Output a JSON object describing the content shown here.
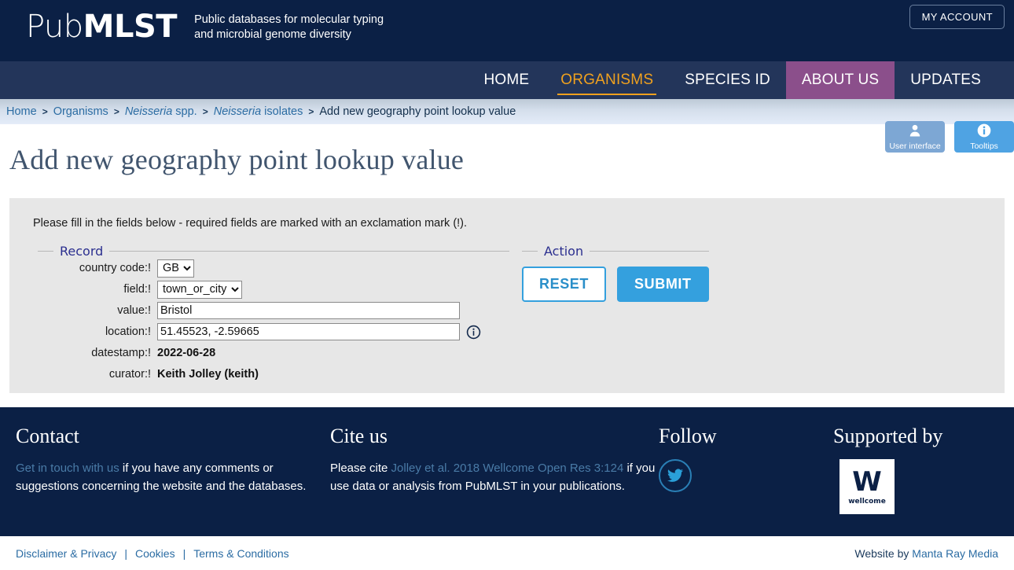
{
  "header": {
    "logo_light": "Pub",
    "logo_bold": "MLST",
    "tagline_line1": "Public databases for molecular typing",
    "tagline_line2": "and microbial genome diversity",
    "my_account_label": "MY ACCOUNT"
  },
  "nav": {
    "items": [
      {
        "label": "HOME",
        "state": "normal"
      },
      {
        "label": "ORGANISMS",
        "state": "active"
      },
      {
        "label": "SPECIES ID",
        "state": "normal"
      },
      {
        "label": "ABOUT US",
        "state": "hovered"
      },
      {
        "label": "UPDATES",
        "state": "normal"
      }
    ],
    "active_color": "#f0a11e",
    "hover_color": "#8b4f8b"
  },
  "breadcrumb": {
    "home": "Home",
    "organisms": "Organisms",
    "genus": "Neisseria",
    "genus_suffix": " spp.",
    "isolates_genus": "Neisseria",
    "isolates_suffix": " isolates",
    "current": "Add new geography point lookup value",
    "separator": ">"
  },
  "utility_buttons": [
    {
      "label": "User interface",
      "icon": "user-icon",
      "color": "#7da7d4"
    },
    {
      "label": "Tooltips",
      "icon": "info-icon",
      "color": "#4fa3e3"
    }
  ],
  "main": {
    "page_title": "Add new geography point lookup value",
    "intro": "Please fill in the fields below - required fields are marked with an exclamation mark (!).",
    "record_legend": "Record",
    "action_legend": "Action",
    "fields": [
      {
        "label": "country code:!",
        "type": "select",
        "value": "GB",
        "options": [
          "GB"
        ]
      },
      {
        "label": "field:!",
        "type": "select",
        "value": "town_or_city",
        "options": [
          "town_or_city"
        ]
      },
      {
        "label": "value:!",
        "type": "text",
        "value": "Bristol",
        "placeholder": ""
      },
      {
        "label": "location:!",
        "type": "text",
        "value": "51.45523, -2.59665",
        "placeholder": "",
        "has_info_icon": true
      },
      {
        "label": "datestamp:!",
        "type": "static",
        "value": "2022-06-28"
      },
      {
        "label": "curator:!",
        "type": "static",
        "value": "Keith Jolley (keith)"
      }
    ],
    "reset_label": "RESET",
    "submit_label": "SUBMIT",
    "accent_blue": "#34a0de"
  },
  "footer": {
    "contact": {
      "heading": "Contact",
      "link": "Get in touch with us",
      "text": " if you have any comments or suggestions concerning the website and the databases."
    },
    "cite": {
      "heading": "Cite us",
      "prefix": "Please cite ",
      "link_part1": "Jolley ",
      "link_italic": "et al.",
      "link_part2": " 2018 Wellcome Open Res 3:124",
      "suffix": " if you use data or analysis from PubMLST in your publications."
    },
    "follow": {
      "heading": "Follow",
      "icon": "twitter-icon"
    },
    "supported": {
      "heading": "Supported by",
      "logo_letter": "W",
      "logo_name": "wellcome"
    }
  },
  "bottom_bar": {
    "links": [
      "Disclaimer & Privacy",
      "Cookies",
      "Terms & Conditions"
    ],
    "separator": "|",
    "credit_prefix": "Website by ",
    "credit_link": "Manta Ray Media"
  }
}
